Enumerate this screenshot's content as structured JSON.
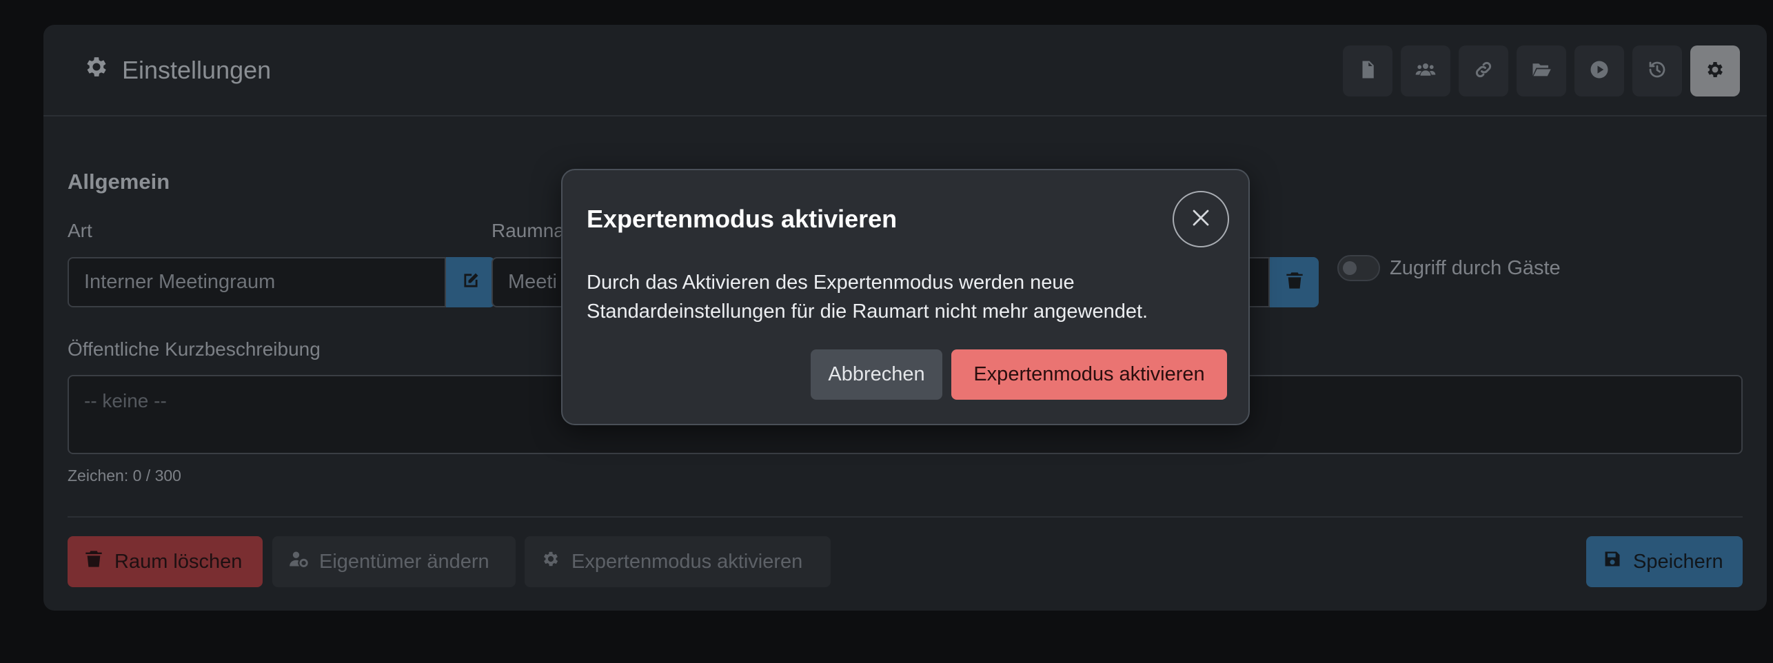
{
  "header": {
    "title": "Einstellungen",
    "toolbar": [
      {
        "icon": "file-icon"
      },
      {
        "icon": "users-icon"
      },
      {
        "icon": "link-icon"
      },
      {
        "icon": "folder-icon"
      },
      {
        "icon": "play-icon"
      },
      {
        "icon": "history-icon"
      },
      {
        "icon": "gear-icon",
        "active": true
      }
    ]
  },
  "form": {
    "section_title": "Allgemein",
    "type_label": "Art",
    "type_value": "Interner Meetingraum",
    "name_label": "Raumna",
    "name_value": "Meeti",
    "guest_access_label": "Zugriff durch Gäste",
    "description_label": "Öffentliche Kurzbeschreibung",
    "description_placeholder": "-- keine --",
    "char_count": "Zeichen: 0 / 300"
  },
  "footer": {
    "delete_label": "Raum löschen",
    "owner_label": "Eigentümer ändern",
    "expert_label": "Expertenmodus aktivieren",
    "save_label": "Speichern"
  },
  "modal": {
    "title": "Expertenmodus aktivieren",
    "body_line1": "Durch das Aktivieren des Expertenmodus werden neue",
    "body_line2": "Standardeinstellungen für die Raumart nicht mehr angewendet.",
    "cancel_label": "Abbrechen",
    "confirm_label": "Expertenmodus aktivieren"
  },
  "colors": {
    "background": "#0d0e10",
    "card": "#1d2024",
    "modal": "#2b2e33",
    "danger": "#ea7472",
    "primary": "#2a5678"
  }
}
